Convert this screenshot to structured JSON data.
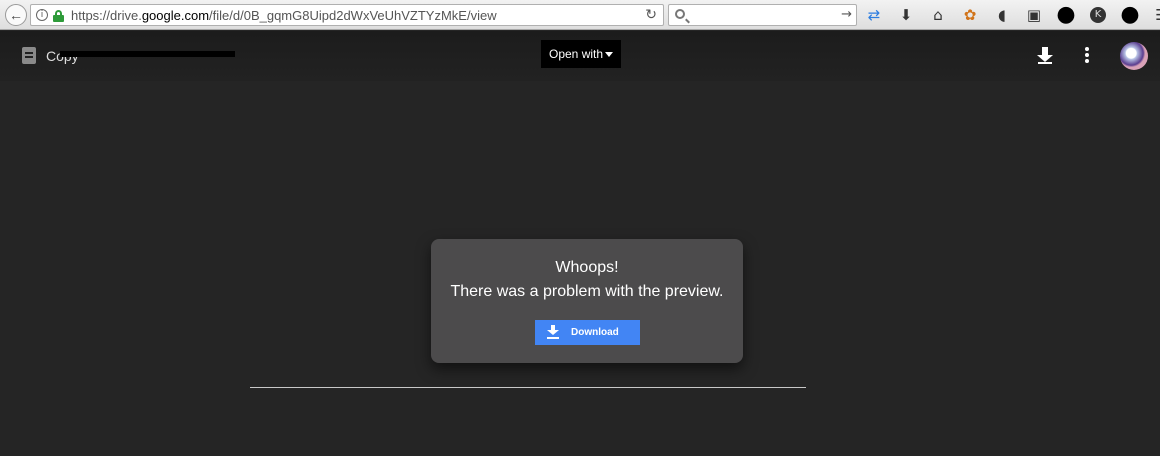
{
  "browser": {
    "url_prefix": "https://drive.",
    "url_host": "google.com",
    "url_path": "/file/d/0B_gqmG8Uipd2dWxVeUhVZTYzMkE/view",
    "search_placeholder": ""
  },
  "viewer": {
    "file_title": "Copy",
    "open_with_label": "Open with"
  },
  "error": {
    "title": "Whoops!",
    "message": "There was a problem with the preview.",
    "download_label": "Download"
  },
  "colors": {
    "background": "#252525",
    "card": "#4c4b4c",
    "download_button": "#4285f4"
  }
}
